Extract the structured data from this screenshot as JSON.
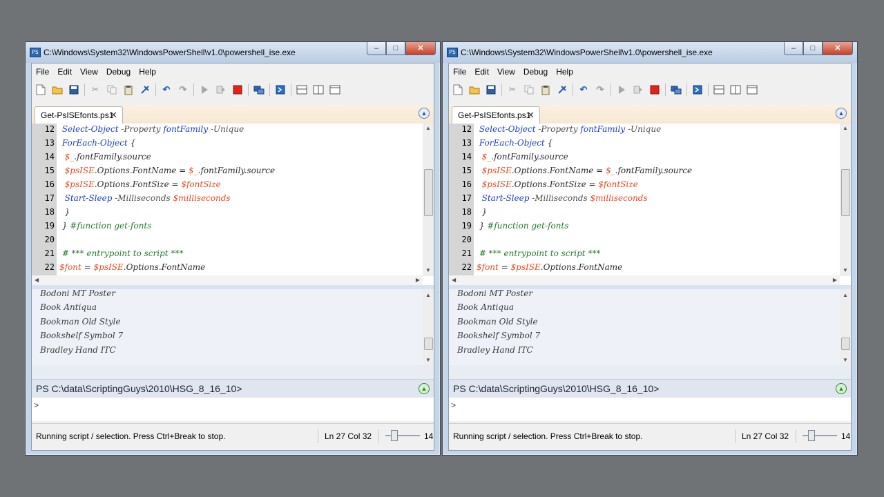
{
  "window": {
    "title": "C:\\Windows\\System32\\WindowsPowerShell\\v1.0\\powershell_ise.exe",
    "app_icon_glyph": "PS",
    "controls": {
      "minimize": "–",
      "maximize": "□",
      "close": "✕"
    }
  },
  "menu": [
    "File",
    "Edit",
    "View",
    "Debug",
    "Help"
  ],
  "toolbar_icons": [
    "new-icon",
    "open-icon",
    "save-icon",
    "cut-icon",
    "copy-icon",
    "paste-icon",
    "clear-icon",
    "undo-icon",
    "redo-icon",
    "run-icon",
    "run-selection-icon",
    "stop-icon",
    "remote-icon",
    "powershell-icon",
    "layout-top-icon",
    "layout-right-icon",
    "layout-max-icon"
  ],
  "tab": {
    "label": "Get-PsISEfonts.ps1",
    "close": "✕"
  },
  "editor": {
    "lines": [
      {
        "num": "12",
        "parts": [
          {
            "t": " Select-Object",
            "c": "cmd"
          },
          {
            "t": " -Property",
            "c": "param"
          },
          {
            "t": " fontFamily",
            "c": "cmd"
          },
          {
            "t": " -Unique",
            "c": "param"
          }
        ]
      },
      {
        "num": "13",
        "parts": [
          {
            "t": " ForEach-Object",
            "c": "cmd"
          },
          {
            "t": " {",
            "c": "prop"
          }
        ]
      },
      {
        "num": "14",
        "parts": [
          {
            "t": "  $_",
            "c": "var"
          },
          {
            "t": ".fontFamily.source",
            "c": "prop"
          }
        ]
      },
      {
        "num": "15",
        "parts": [
          {
            "t": "  $psISE",
            "c": "var"
          },
          {
            "t": ".Options.FontName = ",
            "c": "prop"
          },
          {
            "t": "$_",
            "c": "var"
          },
          {
            "t": ".fontFamily.source",
            "c": "prop"
          }
        ]
      },
      {
        "num": "16",
        "parts": [
          {
            "t": "  $psISE",
            "c": "var"
          },
          {
            "t": ".Options.FontSize = ",
            "c": "prop"
          },
          {
            "t": "$fontSize",
            "c": "var"
          }
        ]
      },
      {
        "num": "17",
        "parts": [
          {
            "t": "  Start-Sleep",
            "c": "cmd"
          },
          {
            "t": " -Milliseconds ",
            "c": "param"
          },
          {
            "t": "$milliseconds",
            "c": "var"
          }
        ]
      },
      {
        "num": "18",
        "parts": [
          {
            "t": "  }",
            "c": "prop"
          }
        ]
      },
      {
        "num": "19",
        "parts": [
          {
            "t": " } ",
            "c": "prop"
          },
          {
            "t": "#function get-fonts",
            "c": "cmt"
          }
        ]
      },
      {
        "num": "20",
        "parts": []
      },
      {
        "num": "21",
        "parts": [
          {
            "t": " # *** entrypoint to script ***",
            "c": "cmt"
          }
        ]
      },
      {
        "num": "22",
        "parts": [
          {
            "t": "$font",
            "c": "var"
          },
          {
            "t": " = ",
            "c": "prop"
          },
          {
            "t": "$psISE",
            "c": "var"
          },
          {
            "t": ".Options.FontName",
            "c": "prop"
          }
        ]
      }
    ]
  },
  "output": {
    "lines": [
      "Bodoni MT Poster",
      "Book Antiqua",
      "Bookman Old Style",
      "Bookshelf Symbol 7",
      "Bradley Hand ITC"
    ]
  },
  "prompt": "PS C:\\data\\ScriptingGuys\\2010\\HSG_8_16_10>",
  "command_caret": ">",
  "status": {
    "message": "Running script / selection.  Press Ctrl+Break to stop.",
    "position": "Ln 27  Col 32",
    "zoom": "14"
  },
  "colors": {
    "cmd": "#1d3fc9",
    "var": "#e8491d",
    "comment": "#237b2b"
  }
}
